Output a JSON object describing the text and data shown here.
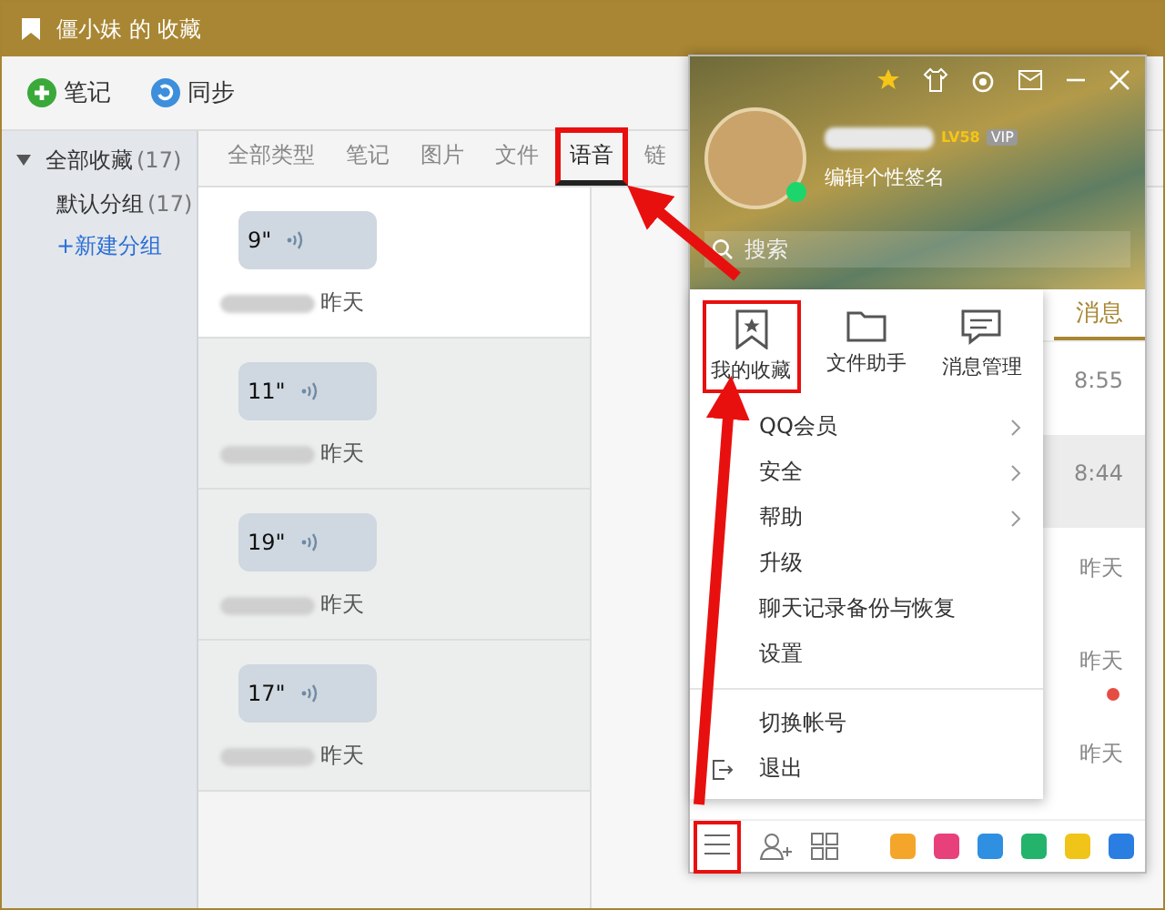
{
  "window": {
    "title": "僵小妹 的 收藏"
  },
  "toolbar": [
    {
      "label": "笔记",
      "kind": "add"
    },
    {
      "label": "同步",
      "kind": "sync"
    }
  ],
  "sidebar": {
    "items": [
      {
        "label": "全部收藏",
        "count": "(17)",
        "expanded": true,
        "children": [
          {
            "label": "默认分组",
            "count": "(17)"
          }
        ]
      }
    ],
    "new_group": "+新建分组"
  },
  "tabs": [
    {
      "label": "全部类型",
      "selected": false,
      "highlighted": false
    },
    {
      "label": "笔记",
      "selected": false,
      "highlighted": false
    },
    {
      "label": "图片",
      "selected": false,
      "highlighted": false
    },
    {
      "label": "文件",
      "selected": false,
      "highlighted": false
    },
    {
      "label": "语音",
      "selected": true,
      "highlighted": true
    },
    {
      "label": "链",
      "selected": false,
      "highlighted": false
    }
  ],
  "voice_items": [
    {
      "duration": "9\"",
      "date": "昨天",
      "selected": true
    },
    {
      "duration": "11\"",
      "date": "昨天",
      "selected": false
    },
    {
      "duration": "19\"",
      "date": "昨天",
      "selected": false
    },
    {
      "duration": "17\"",
      "date": "昨天",
      "selected": false
    }
  ],
  "qq_panel": {
    "level_badge": "LV58",
    "vip_badge": "VIP",
    "signature": "编辑个性签名",
    "search": {
      "placeholder": "搜索"
    },
    "tabs": [
      {
        "label": "消息",
        "selected": true
      }
    ],
    "rows": [
      {
        "time": "8:55",
        "unread": false,
        "selected": false
      },
      {
        "time": "8:44",
        "unread": false,
        "selected": true
      },
      {
        "time": "昨天",
        "unread": false,
        "selected": false
      },
      {
        "time": "昨天",
        "unread": true,
        "selected": false
      },
      {
        "time": "昨天",
        "unread": false,
        "selected": false
      }
    ],
    "menu_button": {
      "highlighted": true
    }
  },
  "menu": {
    "shortcuts": [
      {
        "label": "我的收藏",
        "kind": "star",
        "highlighted": true
      },
      {
        "label": "文件助手",
        "kind": "folder",
        "highlighted": false
      },
      {
        "label": "消息管理",
        "kind": "chat",
        "highlighted": false
      }
    ],
    "items": [
      {
        "label": "QQ会员",
        "kind": "submenu"
      },
      {
        "label": "安全",
        "kind": "submenu"
      },
      {
        "label": "帮助",
        "kind": "submenu"
      },
      {
        "label": "升级",
        "kind": "plain"
      },
      {
        "label": "聊天记录备份与恢复",
        "kind": "plain"
      },
      {
        "label": "设置",
        "kind": "plain"
      },
      {
        "label": "切换帐号",
        "kind": "separated"
      },
      {
        "label": "退出",
        "kind": "exit"
      }
    ]
  }
}
